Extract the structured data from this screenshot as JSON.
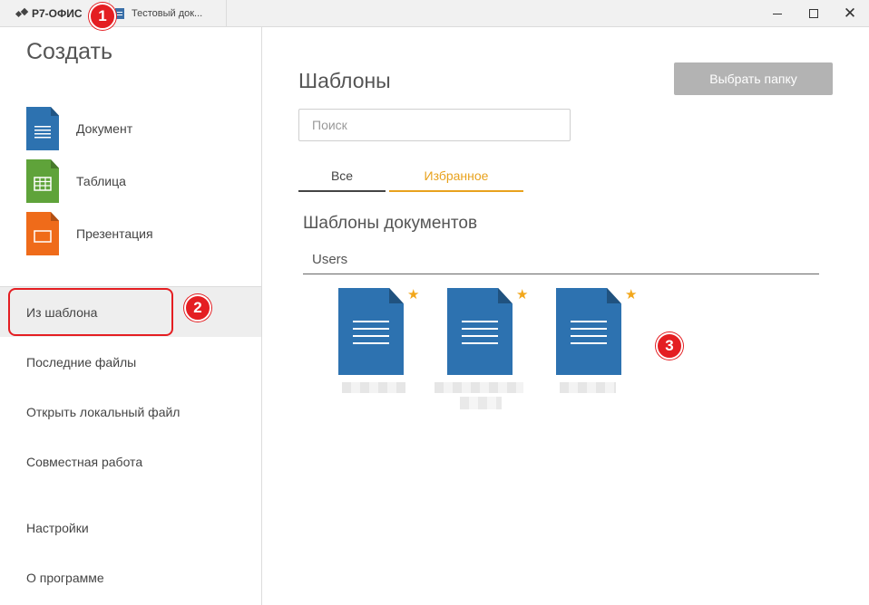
{
  "titlebar": {
    "app_name": "Р7-ОФИС",
    "tab_title": "Тестовый док..."
  },
  "badges": [
    "1",
    "2",
    "3"
  ],
  "sidebar": {
    "create_title": "Создать",
    "create_items": [
      {
        "label": "Документ",
        "icon": "document-icon"
      },
      {
        "label": "Таблица",
        "icon": "spreadsheet-icon"
      },
      {
        "label": "Презентация",
        "icon": "presentation-icon"
      }
    ],
    "nav_items": [
      {
        "label": "Из шаблона",
        "active": true
      },
      {
        "label": "Последние файлы"
      },
      {
        "label": "Открыть локальный файл"
      },
      {
        "label": "Совместная работа"
      },
      {
        "label": "Настройки"
      },
      {
        "label": "О программе"
      }
    ]
  },
  "main": {
    "title": "Шаблоны",
    "choose_folder_label": "Выбрать папку",
    "search_placeholder": "Поиск",
    "tabs": [
      {
        "label": "Все"
      },
      {
        "label": "Избранное",
        "active": true
      }
    ],
    "section_title": "Шаблоны документов",
    "group_label": "Users",
    "templates": [
      {
        "icon": "document-template-icon",
        "favorite": true
      },
      {
        "icon": "document-template-icon",
        "favorite": true
      },
      {
        "icon": "document-template-icon",
        "favorite": true
      }
    ]
  },
  "colors": {
    "accent_orange": "#e8a21d",
    "doc_blue": "#2d72b0",
    "xls_green": "#5fa33a",
    "ppt_orange": "#ef6b1a",
    "badge_red": "#e41e22",
    "star": "#f2a71b"
  }
}
